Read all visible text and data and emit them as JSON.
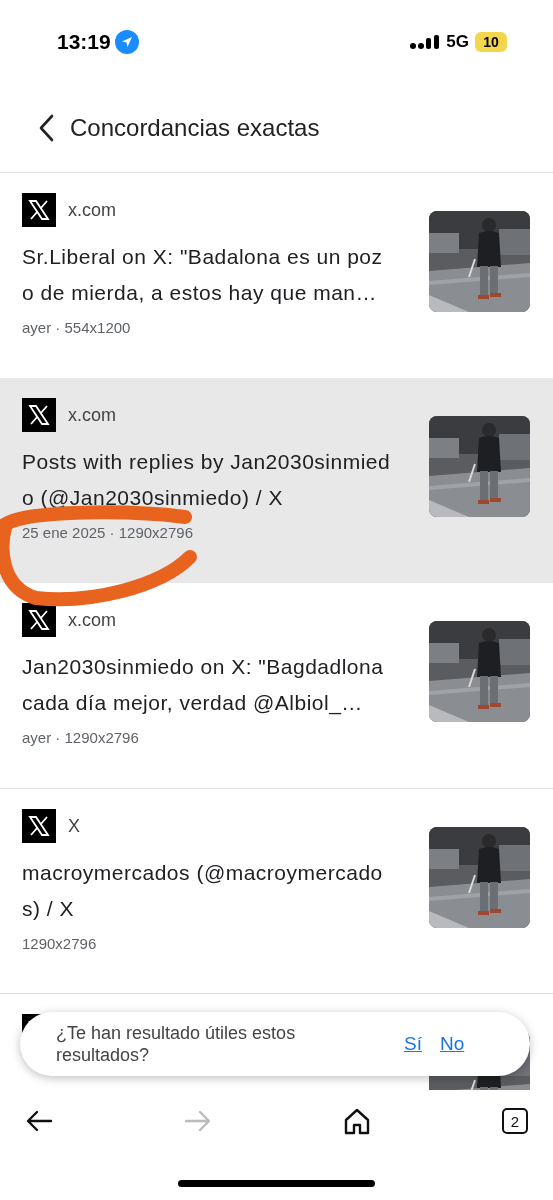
{
  "status_bar": {
    "time": "13:19",
    "network": "5G",
    "battery": "10"
  },
  "header": {
    "title": "Concordancias exactas"
  },
  "results": [
    {
      "source": "x.com",
      "title": "Sr.Liberal on X: \"Badalona es un pozo de mierda, a estos hay que man…",
      "meta": "ayer · 554x1200",
      "highlighted": false
    },
    {
      "source": "x.com",
      "title": "Posts with replies by Jan2030sinmiedo (@Jan2030sinmiedo) / X",
      "meta": "25 ene 2025 · 1290x2796",
      "highlighted": true
    },
    {
      "source": "x.com",
      "title": "Jan2030sinmiedo on X: \"Bagdadlona cada día mejor, verdad @Albiol_…",
      "meta": "ayer · 1290x2796",
      "highlighted": false
    },
    {
      "source": "X",
      "title": "macroymercados (@macroymercados) / X",
      "meta": "1290x2796",
      "highlighted": false
    },
    {
      "highlighted": false
    }
  ],
  "annotation": {
    "kind": "scribble"
  },
  "feedback": {
    "question": "¿Te han resultado útiles estos resultados?",
    "buttons": [
      "Sí",
      "No"
    ]
  },
  "bottom_nav": {
    "back_disabled": false,
    "forward_disabled": true,
    "tab_count": "2"
  }
}
